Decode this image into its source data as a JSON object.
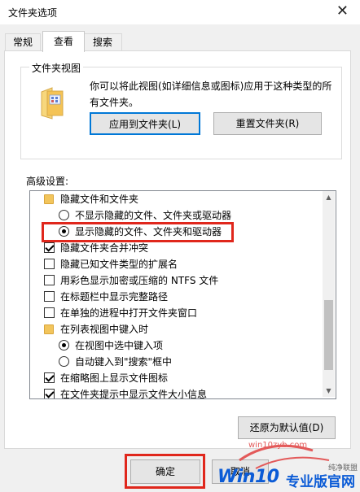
{
  "window": {
    "title": "文件夹选项",
    "close_glyph": "✕"
  },
  "tabs": [
    {
      "label": "常规"
    },
    {
      "label": "查看"
    },
    {
      "label": "搜索"
    }
  ],
  "folder_views": {
    "group_label": "文件夹视图",
    "description": "你可以将此视图(如详细信息或图标)应用于这种类型的所有文件夹。",
    "apply_button": "应用到文件夹(L)",
    "reset_button": "重置文件夹(R)"
  },
  "advanced": {
    "label": "高级设置:",
    "items": [
      {
        "kind": "folder",
        "checked": false,
        "label": "隐藏文件和文件夹"
      },
      {
        "kind": "radio",
        "checked": false,
        "label": "不显示隐藏的文件、文件夹或驱动器"
      },
      {
        "kind": "radio",
        "checked": true,
        "label": "显示隐藏的文件、文件夹和驱动器"
      },
      {
        "kind": "check",
        "checked": true,
        "label": "隐藏文件夹合并冲突"
      },
      {
        "kind": "check",
        "checked": false,
        "label": "隐藏已知文件类型的扩展名"
      },
      {
        "kind": "check",
        "checked": false,
        "label": "用彩色显示加密或压缩的 NTFS 文件"
      },
      {
        "kind": "check",
        "checked": false,
        "label": "在标题栏中显示完整路径"
      },
      {
        "kind": "check",
        "checked": false,
        "label": "在单独的进程中打开文件夹窗口"
      },
      {
        "kind": "folder",
        "checked": false,
        "label": "在列表视图中键入时"
      },
      {
        "kind": "radio",
        "checked": true,
        "label": "在视图中选中键入项"
      },
      {
        "kind": "radio",
        "checked": false,
        "label": "自动键入到\"搜索\"框中"
      },
      {
        "kind": "check",
        "checked": true,
        "label": "在缩略图上显示文件图标"
      },
      {
        "kind": "check",
        "checked": true,
        "label": "在文件夹提示中显示文件大小信息"
      }
    ],
    "restore_button": "还原为默认值(D)"
  },
  "footer": {
    "ok_button": "确定",
    "cancel_button": "取消"
  },
  "watermark": {
    "small": "win10zyb.com",
    "tag": "纯净联盟",
    "big": "Win10",
    "zh": "专业版官网"
  },
  "colors": {
    "highlight": "#e0271c",
    "focus": "#0078d7",
    "watermark_blue": "#0b5bd6"
  }
}
